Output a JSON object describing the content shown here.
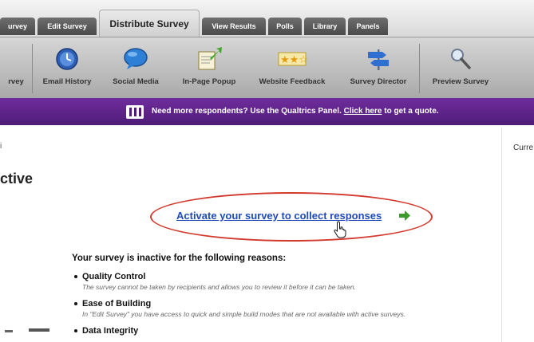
{
  "tabs": [
    {
      "label": "urvey"
    },
    {
      "label": "Edit Survey"
    },
    {
      "label": "Distribute Survey"
    },
    {
      "label": "View Results"
    },
    {
      "label": "Polls"
    },
    {
      "label": "Library"
    },
    {
      "label": "Panels"
    }
  ],
  "toolbar": {
    "items": [
      {
        "label": "rvey",
        "icon": "partial-icon"
      },
      {
        "label": "Email History",
        "icon": "clock-icon"
      },
      {
        "label": "Social Media",
        "icon": "speech-bubble-icon"
      },
      {
        "label": "In-Page Popup",
        "icon": "popup-arrow-icon"
      },
      {
        "label": "Website Feedback",
        "icon": "stars-icon"
      },
      {
        "label": "Survey Director",
        "icon": "signpost-icon"
      },
      {
        "label": "Preview Survey",
        "icon": "magnifier-icon"
      }
    ]
  },
  "banner": {
    "text": "Need more respondents? Use the Qualtrics Panel.",
    "link": "Click here",
    "suffix": "to get a quote.",
    "icon": "panel-people-icon"
  },
  "page": {
    "breadcrumb": "i",
    "current_label": "Curre",
    "heading": "ctive"
  },
  "activate": {
    "label": "Activate your survey to collect responses",
    "arrow_icon": "green-arrow-icon",
    "cursor_icon": "hand-cursor-icon"
  },
  "reasons": {
    "title": "Your survey is inactive for the following reasons:",
    "items": [
      {
        "title": "Quality Control",
        "desc": "The survey cannot be taken by recipients and allows you to review it before it can be taken."
      },
      {
        "title": "Ease of Building",
        "desc": "In \"Edit Survey\" you have access to quick and simple build modes that are not available with active surveys."
      },
      {
        "title": "Data Integrity",
        "desc": ""
      }
    ]
  },
  "colors": {
    "banner": "#5a2189",
    "link": "#1e4bb8",
    "ellipse": "#d23a2e"
  }
}
